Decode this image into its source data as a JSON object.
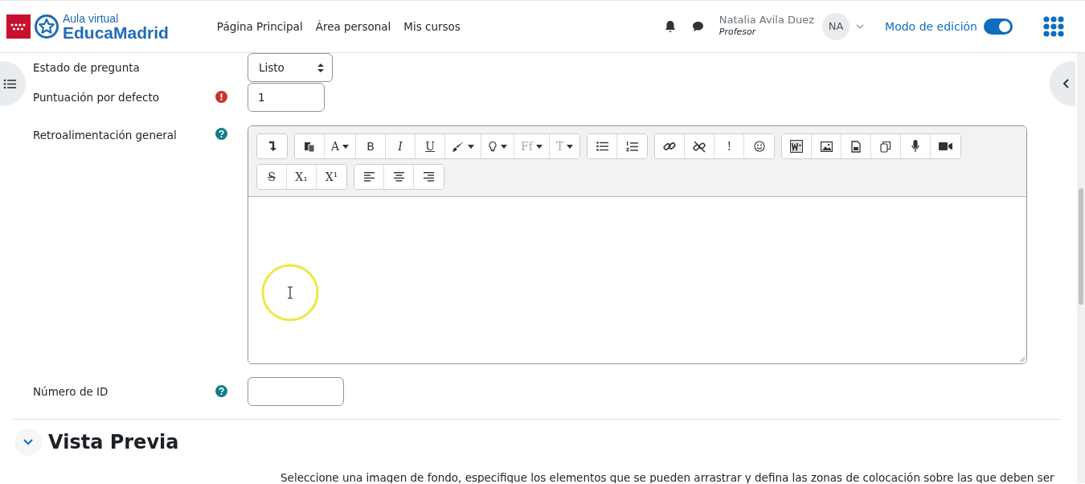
{
  "header": {
    "logo_top": "Aula virtual",
    "logo_bottom": "EducaMadrid",
    "nav": [
      {
        "label": "Página Principal"
      },
      {
        "label": "Área personal"
      },
      {
        "label": "Mis cursos"
      }
    ],
    "user": {
      "name": "Natalia Avila Duez",
      "role": "Profesor",
      "initials": "NA"
    },
    "edit_mode": {
      "label": "Modo de edición",
      "on": true
    }
  },
  "form": [
    {
      "kind": "select",
      "label": "Estado de pregunta",
      "value": "Listo"
    },
    {
      "kind": "text",
      "label": "Puntuación por defecto",
      "required": true,
      "value": "1"
    },
    {
      "kind": "editor",
      "label": "Retroalimentación general",
      "help": true,
      "toolbar": [
        [
          {
            "kind": "collapse"
          }
        ],
        [
          {
            "kind": "paste"
          },
          {
            "kind": "font-color",
            "glyph": "A",
            "dropdown": true
          },
          {
            "kind": "bold",
            "glyph": "B"
          },
          {
            "kind": "italic",
            "glyph": "I"
          },
          {
            "kind": "underline",
            "glyph": "U"
          },
          {
            "kind": "brush",
            "dropdown": true
          },
          {
            "kind": "bulb",
            "dropdown": true
          },
          {
            "kind": "font-family",
            "glyph": "Ff",
            "dropdown": true
          },
          {
            "kind": "font-size",
            "glyph": "T",
            "dropdown": true
          }
        ],
        [
          {
            "kind": "ul"
          },
          {
            "kind": "ol"
          }
        ],
        [
          {
            "kind": "link"
          },
          {
            "kind": "unlink"
          },
          {
            "kind": "plain",
            "glyph": "!"
          },
          {
            "kind": "smile"
          }
        ],
        [
          {
            "kind": "word"
          },
          {
            "kind": "image"
          },
          {
            "kind": "file"
          },
          {
            "kind": "copy"
          },
          {
            "kind": "mic"
          },
          {
            "kind": "video"
          }
        ],
        [
          {
            "kind": "strike",
            "glyph": "S"
          },
          {
            "kind": "plain",
            "glyph": "X₁"
          },
          {
            "kind": "plain",
            "glyph": "X¹"
          }
        ],
        [
          {
            "kind": "align-left"
          },
          {
            "kind": "align-center"
          },
          {
            "kind": "align-right"
          }
        ]
      ]
    },
    {
      "kind": "text",
      "label": "Número de ID",
      "help": true
    }
  ],
  "section": {
    "title": "Vista Previa",
    "expanded": true,
    "text": "Seleccione una imagen de fondo, especifique los elementos que se pueden arrastrar y defina las zonas de colocación sobre las que deben ser"
  }
}
